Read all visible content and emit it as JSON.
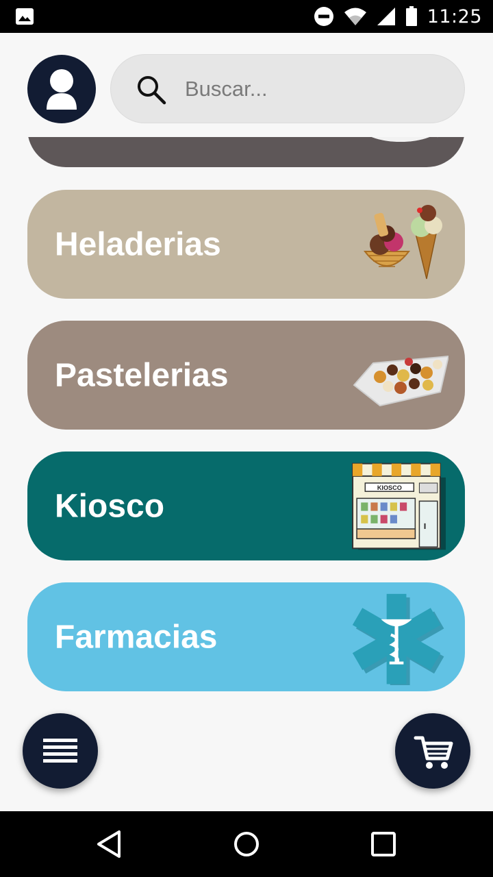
{
  "status_bar": {
    "time": "11:25",
    "icons": [
      "image-icon",
      "dnd-icon",
      "wifi-icon",
      "signal-icon",
      "battery-icon"
    ]
  },
  "header": {
    "avatar_icon": "user-icon",
    "search": {
      "icon": "search-icon",
      "placeholder": "Buscar...",
      "value": ""
    }
  },
  "categories": [
    {
      "label": "",
      "color": "#5e5758",
      "image": "coffee-cup-image"
    },
    {
      "label": "Heladerias",
      "color": "#c2b6a0",
      "image": "ice-cream-image"
    },
    {
      "label": "Pastelerias",
      "color": "#9d8b7f",
      "image": "pastry-tray-image"
    },
    {
      "label": "Kiosco",
      "color": "#066b6b",
      "image": "kiosk-image",
      "image_text": "KIOSCO"
    },
    {
      "label": "Farmacias",
      "color": "#61c2e4",
      "image": "pharmacy-star-image"
    }
  ],
  "fab": {
    "menu_icon": "menu-icon",
    "cart_icon": "cart-icon",
    "color": "#121c33"
  },
  "nav_bar": {
    "icons": [
      "back-icon",
      "home-icon",
      "recents-icon"
    ]
  }
}
